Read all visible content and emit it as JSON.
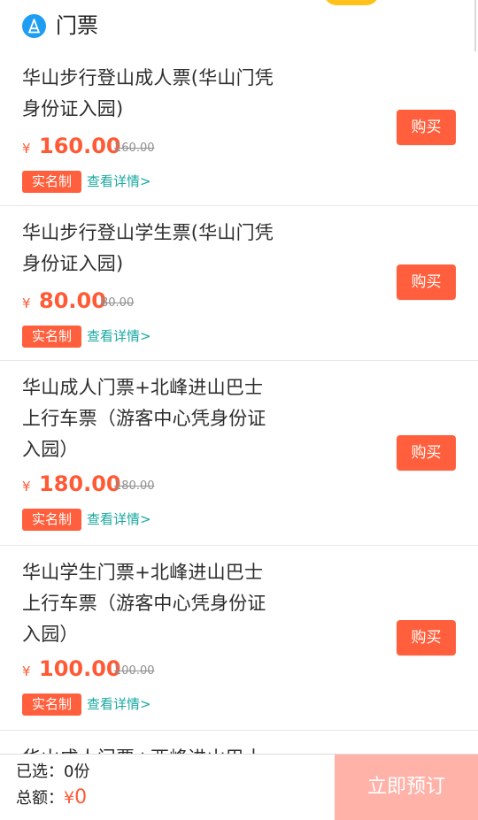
{
  "header": {
    "section_title": "门票",
    "section_icon": "ticket-category-icon",
    "accent_color": "#ffc21a"
  },
  "tickets": [
    {
      "name": "华山步行登山成人票(华山门凭身份证入园)",
      "currency": "¥",
      "price": "160.00",
      "original_price": "160.00",
      "tag": "实名制",
      "detail_link": "查看详情>",
      "buy_label": "购买"
    },
    {
      "name": "华山步行登山学生票(华山门凭身份证入园)",
      "currency": "¥",
      "price": "80.00",
      "original_price": "80.00",
      "tag": "实名制",
      "detail_link": "查看详情>",
      "buy_label": "购买"
    },
    {
      "name": "华山成人门票+北峰进山巴士上行车票（游客中心凭身份证入园）",
      "currency": "¥",
      "price": "180.00",
      "original_price": "180.00",
      "tag": "实名制",
      "detail_link": "查看详情>",
      "buy_label": "购买"
    },
    {
      "name": "华山学生门票+北峰进山巴士上行车票（游客中心凭身份证入园）",
      "currency": "¥",
      "price": "100.00",
      "original_price": "100.00",
      "tag": "实名制",
      "detail_link": "查看详情>",
      "buy_label": "购买"
    }
  ],
  "next_item_preview": "华山成人门票+西峰进山巴士",
  "footer": {
    "selected_label": "已选：",
    "selected_count": "0份",
    "total_label": "总额：",
    "total_currency": "¥",
    "total_value": "0",
    "order_button_label": "立即预订"
  },
  "colors": {
    "primary": "#ff5f3c",
    "price": "#ff5a35",
    "detail_link": "#17a9a0",
    "section_icon": "#1e9df2",
    "order_button_disabled": "#ffb2a8"
  }
}
